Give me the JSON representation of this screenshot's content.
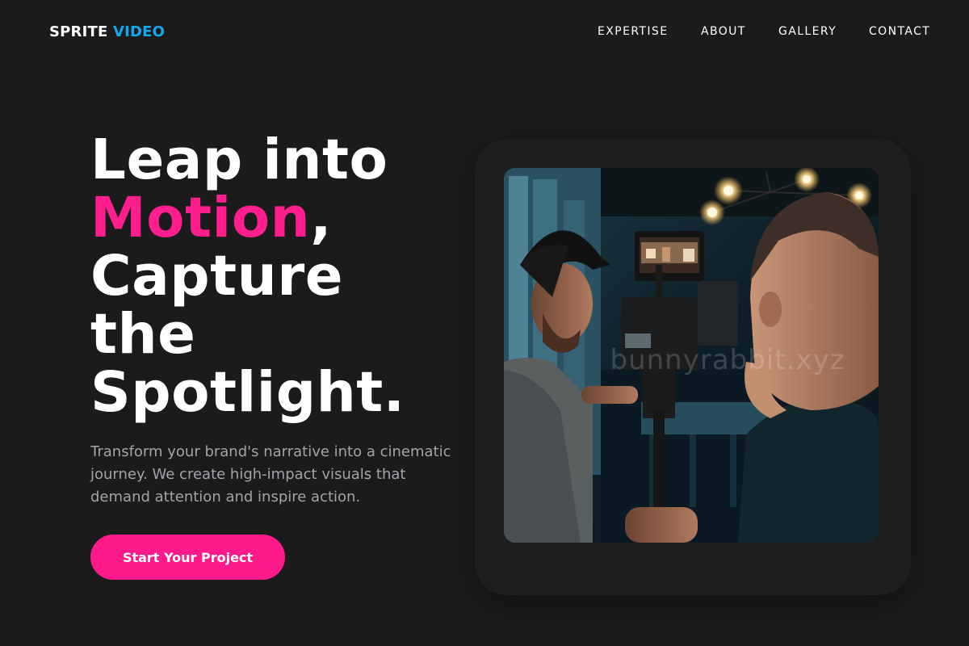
{
  "header": {
    "logo_brand": "SPRITE",
    "logo_accent": "VIDEO",
    "nav": [
      "EXPERTISE",
      "ABOUT",
      "GALLERY",
      "CONTACT"
    ]
  },
  "hero": {
    "title_line1": "Leap into",
    "title_highlight": "Motion",
    "title_comma": ",",
    "title_line3": "Capture",
    "title_line4": "the",
    "title_line5": "Spotlight.",
    "subtitle": "Transform your brand's narrative into a cinematic journey. We create high-impact visuals that demand attention and inspire action.",
    "cta_label": "Start Your Project"
  },
  "media": {
    "watermark": "bunnyrabbit.xyz",
    "alt": "Two videographers operating a cinema camera rig in a dimly lit cafe"
  },
  "colors": {
    "background": "#1b1b1c",
    "accent_pink": "#ff1e8d",
    "accent_blue": "#12a8ec",
    "muted_text": "#a3a3aa"
  }
}
